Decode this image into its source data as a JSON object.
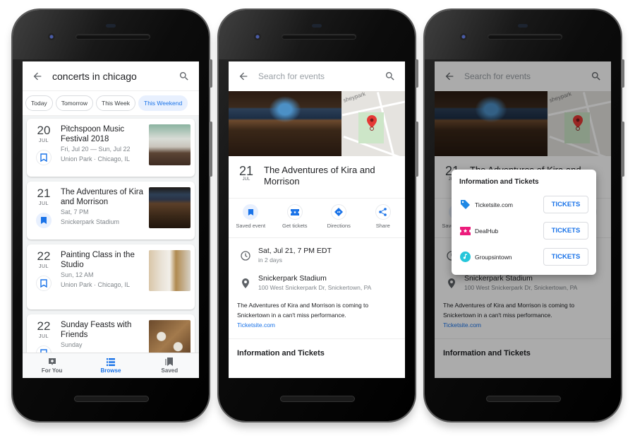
{
  "phone1": {
    "search_query": "concerts in chicago",
    "chips": [
      {
        "label": "Today",
        "active": false
      },
      {
        "label": "Tomorrow",
        "active": false
      },
      {
        "label": "This Week",
        "active": false
      },
      {
        "label": "This Weekend",
        "active": true
      }
    ],
    "events": [
      {
        "day": "20",
        "month": "JUL",
        "title": "Pitchspoon Music Festival 2018",
        "when": "Fri, Jul 20 — Sun, Jul 22",
        "where": "Union Park · Chicago, IL",
        "saved": false
      },
      {
        "day": "21",
        "month": "JUL",
        "title": "The Adventures of Kira and Morrison",
        "when": "Sat, 7 PM",
        "where": "Snickerpark Stadium",
        "saved": true
      },
      {
        "day": "22",
        "month": "JUL",
        "title": "Painting Class in the Studio",
        "when": "Sun, 12 AM",
        "where": "Union Park · Chicago, IL",
        "saved": false
      },
      {
        "day": "22",
        "month": "JUL",
        "title": "Sunday Feasts with Friends",
        "when": "Sunday",
        "where": "",
        "saved": false
      }
    ],
    "bottom_nav": [
      {
        "label": "For You",
        "icon": "for-you-icon",
        "active": false
      },
      {
        "label": "Browse",
        "icon": "list-icon",
        "active": true
      },
      {
        "label": "Saved",
        "icon": "saved-icon",
        "active": false
      }
    ]
  },
  "detail": {
    "search_placeholder": "Search for events",
    "map_label": "sheypark",
    "day": "21",
    "month": "JUL",
    "title": "The Adventures of Kira and Morrison",
    "actions": [
      {
        "label": "Saved event",
        "icon": "bookmark-icon"
      },
      {
        "label": "Get tickets",
        "icon": "ticket-icon"
      },
      {
        "label": "Directions",
        "icon": "directions-icon"
      },
      {
        "label": "Share",
        "icon": "share-icon"
      }
    ],
    "datetime": "Sat, Jul 21, 7 PM EDT",
    "relative": "in 2 days",
    "venue": "Snickerpark Stadium",
    "address": "100 West Snickerpark Dr, Snickertown, PA",
    "description": "The Adventures of Kira and Morrison is coming to Snickertown in a can't miss performance.",
    "link": "Ticketsite.com",
    "section_title": "Information and Tickets"
  },
  "dialog": {
    "title": "Information and Tickets",
    "providers": [
      {
        "name": "Ticketsite.com",
        "icon": "tag-icon",
        "color": "#1e88e5",
        "button": "TICKETS"
      },
      {
        "name": "DealHub",
        "icon": "ticket-star-icon",
        "color": "#ec407a",
        "button": "TICKETS"
      },
      {
        "name": "Groupsintown",
        "icon": "music-note-icon",
        "color": "#26c6da",
        "button": "TICKETS"
      }
    ]
  },
  "colors": {
    "accent": "#1a73e8",
    "chip_active_bg": "#e8f0fe",
    "pin": "#e53935"
  }
}
